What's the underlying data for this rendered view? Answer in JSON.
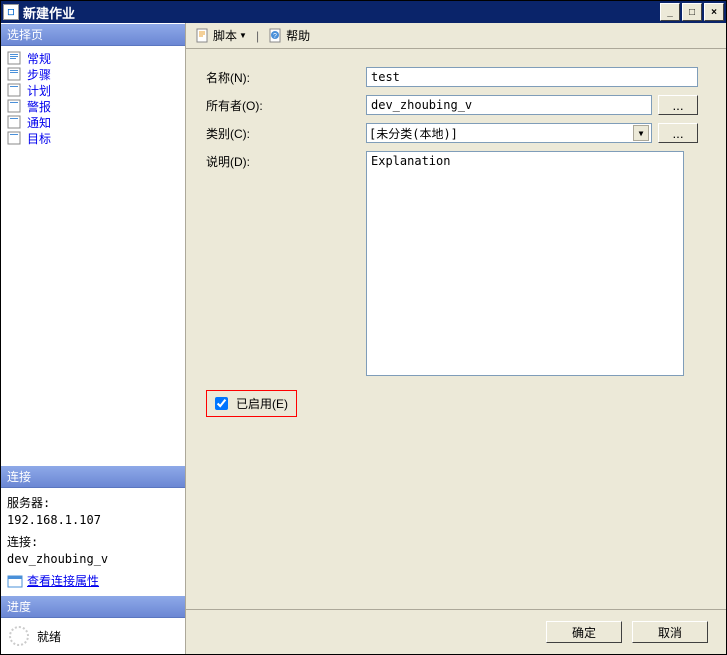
{
  "window": {
    "title": "新建作业"
  },
  "leftpanel": {
    "select_header": "选择页",
    "nav_items": [
      {
        "label": "常规"
      },
      {
        "label": "步骤"
      },
      {
        "label": "计划"
      },
      {
        "label": "警报"
      },
      {
        "label": "通知"
      },
      {
        "label": "目标"
      }
    ],
    "connection_header": "连接",
    "server_label": "服务器:",
    "server_value": "192.168.1.107",
    "conn_label": "连接:",
    "conn_value": "dev_zhoubing_v",
    "view_props": "查看连接属性",
    "progress_header": "进度",
    "progress_status": "就绪"
  },
  "toolbar": {
    "script_label": "脚本",
    "help_label": "帮助"
  },
  "form": {
    "name_label": "名称(N):",
    "name_value": "test",
    "owner_label": "所有者(O):",
    "owner_value": "dev_zhoubing_v",
    "category_label": "类别(C):",
    "category_value": "[未分类(本地)]",
    "desc_label": "说明(D):",
    "desc_value": "Explanation",
    "enabled_label": "已启用(E)",
    "ellipsis": "..."
  },
  "buttons": {
    "ok": "确定",
    "cancel": "取消"
  }
}
